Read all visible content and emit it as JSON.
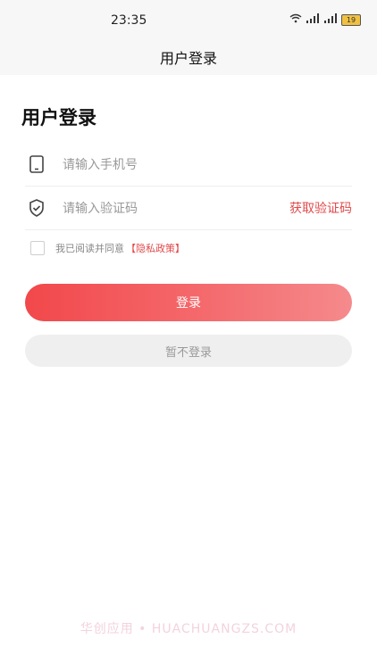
{
  "status_bar": {
    "time": "23:35",
    "battery": "19"
  },
  "nav": {
    "title": "用户登录"
  },
  "page": {
    "heading": "用户登录"
  },
  "form": {
    "phone": {
      "placeholder": "请输入手机号"
    },
    "code": {
      "placeholder": "请输入验证码",
      "action": "获取验证码"
    },
    "agreement": {
      "text": "我已阅读并同意",
      "policy_link": "【隐私政策】"
    }
  },
  "buttons": {
    "login": "登录",
    "skip": "暂不登录"
  },
  "watermark": "华创应用 • HUACHUANGZS.COM",
  "colors": {
    "accent": "#f2484b",
    "link": "#e04a4a"
  },
  "icons": [
    "phone-icon",
    "shield-check-icon",
    "wifi-icon",
    "signal-icon",
    "battery-icon"
  ]
}
